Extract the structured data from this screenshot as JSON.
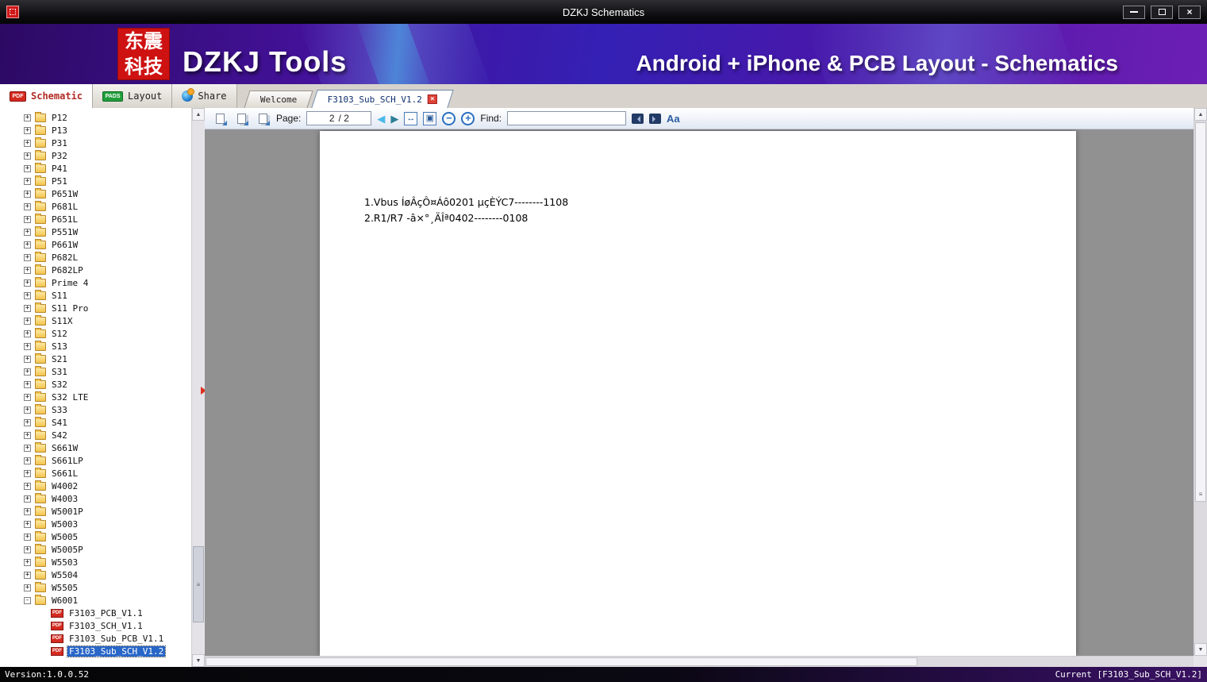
{
  "window": {
    "title": "DZKJ Schematics"
  },
  "header": {
    "logo_line1": "东震",
    "logo_line2": "科技",
    "brand": "DZKJ Tools",
    "tagline": "Android + iPhone & PCB Layout - Schematics"
  },
  "tabs": {
    "schematic": "Schematic",
    "layout": "Layout",
    "share": "Share",
    "pdf_badge": "PDF",
    "pads_badge": "PADS",
    "doc_tabs": [
      {
        "label": "Welcome",
        "active": false
      },
      {
        "label": "F3103_Sub_SCH_V1.2",
        "active": true
      }
    ]
  },
  "toolbar": {
    "page_label": "Page:",
    "page_value": "2",
    "page_total": "/ 2",
    "find_label": "Find:",
    "find_value": ""
  },
  "icons": {
    "close": "×",
    "zoom_out": "−",
    "zoom_in": "+",
    "fit_width": "↔",
    "fit_page": "▣",
    "prev_arrow": "◀",
    "next_arrow": "▶",
    "arrow_up": "▲",
    "arrow_down": "▼",
    "grip": "≡",
    "match_case": "Aa"
  },
  "sidebar": {
    "pdf_badge": "PDF",
    "items": [
      {
        "label": "P12",
        "type": "folder",
        "state": "collapsed"
      },
      {
        "label": "P13",
        "type": "folder",
        "state": "collapsed"
      },
      {
        "label": "P31",
        "type": "folder",
        "state": "collapsed"
      },
      {
        "label": "P32",
        "type": "folder",
        "state": "collapsed"
      },
      {
        "label": "P41",
        "type": "folder",
        "state": "collapsed"
      },
      {
        "label": "P51",
        "type": "folder",
        "state": "collapsed"
      },
      {
        "label": "P651W",
        "type": "folder",
        "state": "collapsed"
      },
      {
        "label": "P681L",
        "type": "folder",
        "state": "collapsed"
      },
      {
        "label": "P651L",
        "type": "folder",
        "state": "collapsed"
      },
      {
        "label": "P551W",
        "type": "folder",
        "state": "collapsed"
      },
      {
        "label": "P661W",
        "type": "folder",
        "state": "collapsed"
      },
      {
        "label": "P682L",
        "type": "folder",
        "state": "collapsed"
      },
      {
        "label": "P682LP",
        "type": "folder",
        "state": "collapsed"
      },
      {
        "label": "Prime 4",
        "type": "folder",
        "state": "collapsed"
      },
      {
        "label": "S11",
        "type": "folder",
        "state": "collapsed"
      },
      {
        "label": "S11 Pro",
        "type": "folder",
        "state": "collapsed"
      },
      {
        "label": "S11X",
        "type": "folder",
        "state": "collapsed"
      },
      {
        "label": "S12",
        "type": "folder",
        "state": "collapsed"
      },
      {
        "label": "S13",
        "type": "folder",
        "state": "collapsed"
      },
      {
        "label": "S21",
        "type": "folder",
        "state": "collapsed"
      },
      {
        "label": "S31",
        "type": "folder",
        "state": "collapsed"
      },
      {
        "label": "S32",
        "type": "folder",
        "state": "collapsed"
      },
      {
        "label": "S32 LTE",
        "type": "folder",
        "state": "collapsed"
      },
      {
        "label": "S33",
        "type": "folder",
        "state": "collapsed"
      },
      {
        "label": "S41",
        "type": "folder",
        "state": "collapsed"
      },
      {
        "label": "S42",
        "type": "folder",
        "state": "collapsed"
      },
      {
        "label": "S661W",
        "type": "folder",
        "state": "collapsed"
      },
      {
        "label": "S661LP",
        "type": "folder",
        "state": "collapsed"
      },
      {
        "label": "S661L",
        "type": "folder",
        "state": "collapsed"
      },
      {
        "label": "W4002",
        "type": "folder",
        "state": "collapsed"
      },
      {
        "label": "W4003",
        "type": "folder",
        "state": "collapsed"
      },
      {
        "label": "W5001P",
        "type": "folder",
        "state": "collapsed"
      },
      {
        "label": "W5003",
        "type": "folder",
        "state": "collapsed"
      },
      {
        "label": "W5005",
        "type": "folder",
        "state": "collapsed"
      },
      {
        "label": "W5005P",
        "type": "folder",
        "state": "collapsed"
      },
      {
        "label": "W5503",
        "type": "folder",
        "state": "collapsed"
      },
      {
        "label": "W5504",
        "type": "folder",
        "state": "collapsed"
      },
      {
        "label": "W5505",
        "type": "folder",
        "state": "collapsed"
      },
      {
        "label": "W6001",
        "type": "folder",
        "state": "expanded"
      },
      {
        "label": "F3103_PCB_V1.1",
        "type": "pdf"
      },
      {
        "label": "F3103_SCH_V1.1",
        "type": "pdf"
      },
      {
        "label": "F3103_Sub_PCB_V1.1",
        "type": "pdf"
      },
      {
        "label": "F3103_Sub_SCH_V1.2",
        "type": "pdf",
        "selected": true
      }
    ]
  },
  "document": {
    "lines": [
      "1.Vbus ÍøÂçÔ¤Áô0201 µçÈÝC7--------1108",
      "2.R1/R7 -â×°¸ÄÎª0402--------0108"
    ]
  },
  "statusbar": {
    "version": "Version:1.0.0.52",
    "current": "Current [F3103_Sub_SCH_V1.2]"
  }
}
